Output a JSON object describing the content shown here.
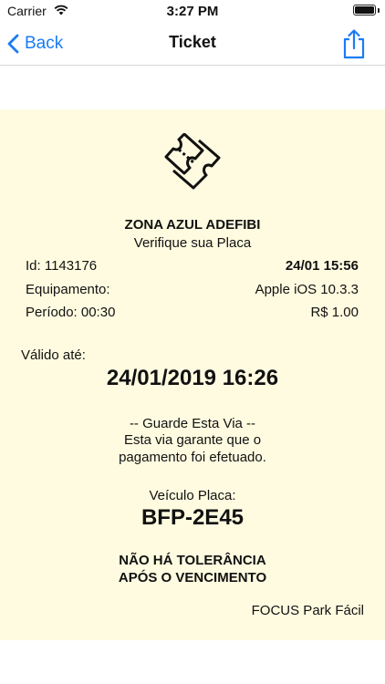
{
  "status_bar": {
    "carrier": "Carrier",
    "time": "3:27 PM"
  },
  "nav": {
    "back_label": "Back",
    "title": "Ticket"
  },
  "colors": {
    "accent": "#1a7cf5",
    "ticket_background": "#fffbe0"
  },
  "ticket": {
    "icon": "ticket-icon",
    "zone_name": "ZONA AZUL ADEFIBI",
    "check_plate": "Verifique sua Placa",
    "id_label": "Id: 1143176",
    "datetime": "24/01 15:56",
    "equipment_label": "Equipamento:",
    "equipment_value": "Apple iOS 10.3.3",
    "period_label": "Período: 00:30",
    "price": "R$ 1.00",
    "valid_until_label": "Válido até:",
    "valid_until_value": "24/01/2019 16:26",
    "keep_receipt": "-- Guarde Esta Via --",
    "guarantee_line1": "Esta via garante que o",
    "guarantee_line2": "pagamento foi efetuado.",
    "vehicle_plate_label": "Veículo Placa:",
    "vehicle_plate": "BFP-2E45",
    "no_tolerance_line1": "NÃO HÁ TOLERÂNCIA",
    "no_tolerance_line2": "APÓS O VENCIMENTO",
    "footer_brand": "FOCUS Park Fácil"
  }
}
